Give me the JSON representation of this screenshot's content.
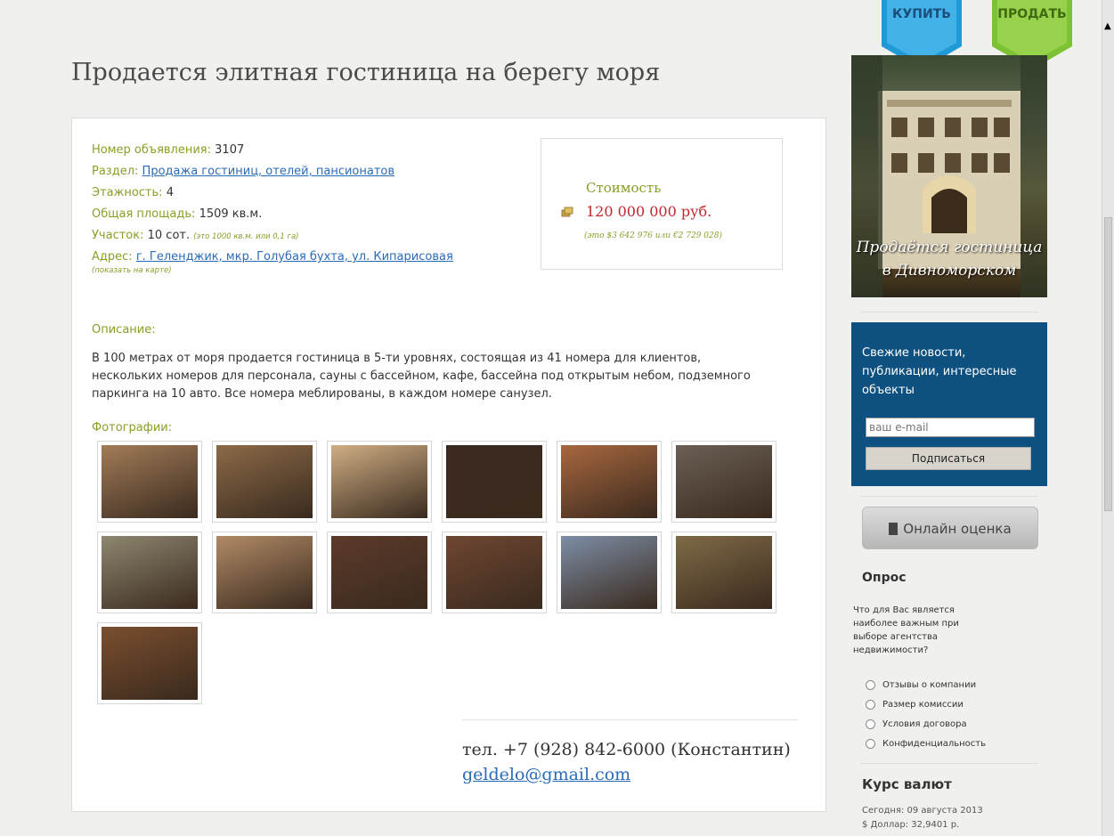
{
  "title": "Продается элитная гостиница на берегу моря",
  "info": {
    "number_label": "Номер объявления:",
    "number_value": "3107",
    "section_label": "Раздел:",
    "section_link": "Продажа гостиниц, отелей, пансионатов",
    "floors_label": "Этажность:",
    "floors_value": "4",
    "area_label": "Общая площадь:",
    "area_value": "1509 кв.м.",
    "plot_label": "Участок:",
    "plot_value": "10 сот.",
    "plot_note": "(это 1000 кв.м. или 0,1 га)",
    "address_label": "Адрес:",
    "address_link": "г. Геленджик, мкр. Голубая бухта, ул. Кипарисовая",
    "map_note": "(показать на карте)"
  },
  "price": {
    "label": "Стоимость",
    "value": "120 000 000 руб.",
    "converted": "(это $3 642 976 или €2 729 028)"
  },
  "description": {
    "label": "Описание:",
    "text": "В 100 метрах от моря продается гостиница в 5-ти уровнях, состоящая из 41 номера для клиентов, нескольких номеров для персонала, сауны с бассейном, кафе, бассейна под открытым небом, подземного паркинга на 10 авто. Все номера меблированы, в каждом номере санузел."
  },
  "photos": {
    "label": "Фотографии:",
    "colors": [
      "#a27c58",
      "#8b6a48",
      "#cfae84",
      "#3b2a20",
      "#a8673f",
      "#6b5f55",
      "#8e8670",
      "#b18a66",
      "#5c3a2a",
      "#6e4631",
      "#7d8ea6",
      "#7f6a46",
      "#7a4e2e"
    ]
  },
  "contact": {
    "phone": "тел. +7 (928) 842-6000 (Константин)",
    "email": "geldelo@gmail.com"
  },
  "sidebar": {
    "buy": "КУПИТЬ",
    "sell": "ПРОДАТЬ",
    "banner_line1": "Продаётся гостиница",
    "banner_line2": "в Дивноморском",
    "subscribe_text": "Свежие новости, публикации, интересные объекты",
    "email_placeholder": "ваш e-mail",
    "subscribe_button": "Подписаться",
    "online_button": "Онлайн оценка",
    "poll_title": "Опрос",
    "poll_question": "Что для Вас является наиболее важным при выборе агентства недвижимости?",
    "poll_options": [
      "Отзывы о компании",
      "Размер комиссии",
      "Условия договора",
      "Конфиденциальность"
    ],
    "rates_title": "Курс валют",
    "rates_date": "Сегодня: 09 августа 2013",
    "rates_usd": "$ Доллар: 32,9401 р."
  },
  "colors": {
    "accent_green": "#86a026",
    "link_blue": "#2a6bb8",
    "price_red": "#c0272d",
    "subscribe_bg": "#0e5080",
    "buy_tab": "#1f9ad6",
    "sell_tab": "#7cc232"
  }
}
